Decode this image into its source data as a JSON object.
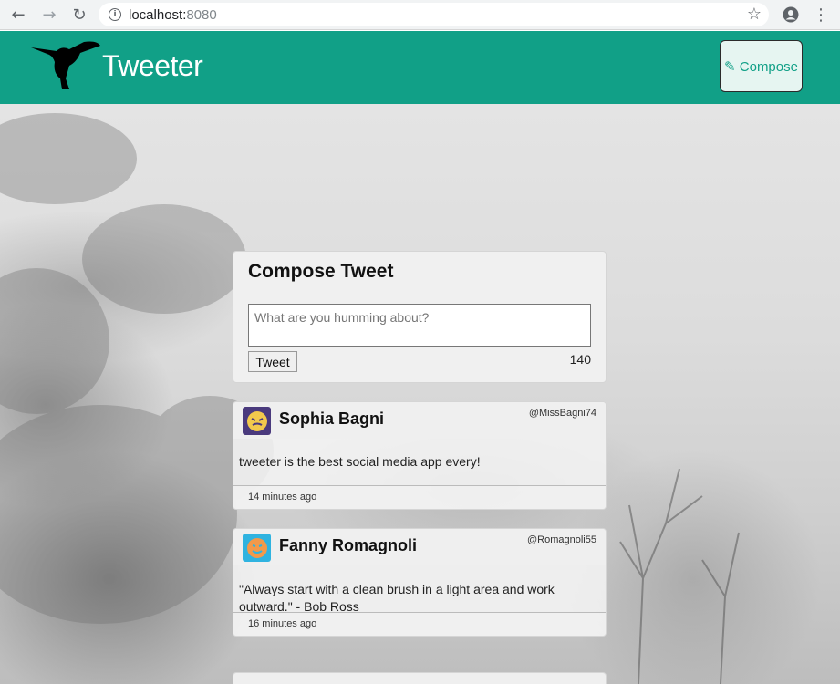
{
  "browser": {
    "url_host": "localhost:",
    "url_port": "8080"
  },
  "header": {
    "brand": "Tweeter",
    "compose_label": "✎ Compose"
  },
  "compose": {
    "title": "Compose Tweet",
    "placeholder": "What are you humming about?",
    "tweet_button": "Tweet",
    "counter": "140"
  },
  "tweets": [
    {
      "name": "Sophia Bagni",
      "handle": "@MissBagni74",
      "text": "tweeter is the best social media app every!",
      "time": "14 minutes ago"
    },
    {
      "name": "Fanny Romagnoli",
      "handle": "@Romagnoli55",
      "text": "\"Always start with a clean brush in a light area and work outward.\" - Bob Ross",
      "time": "16 minutes ago"
    }
  ],
  "colors": {
    "brand": "#11a087"
  }
}
